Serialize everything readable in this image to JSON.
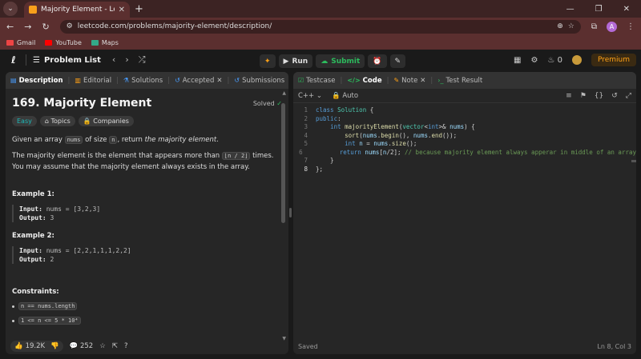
{
  "browser": {
    "tab_title": "Majority Element - LeetCode",
    "tab_close": "✕",
    "new_tab": "+",
    "url": "leetcode.com/problems/majority-element/description/",
    "profile_initial": "A",
    "bookmarks": [
      "Gmail",
      "YouTube",
      "Maps"
    ]
  },
  "leetcode_nav": {
    "problem_list": "Problem List",
    "run": "Run",
    "submit": "Submit",
    "streak": "0",
    "premium": "Premium"
  },
  "left_tabs": {
    "description": "Description",
    "editorial": "Editorial",
    "solutions": "Solutions",
    "accepted": "Accepted",
    "submissions": "Submissions"
  },
  "problem": {
    "title": "169. Majority Element",
    "status": "Solved",
    "difficulty": "Easy",
    "topics": "Topics",
    "companies": "Companies",
    "intro_1": "Given an array ",
    "intro_code_1": "nums",
    "intro_2": " of size ",
    "intro_code_2": "n",
    "intro_3": ", return ",
    "intro_em": "the majority element",
    "intro_4": ".",
    "p2_1": "The majority element is the element that appears more than ",
    "p2_code": "⌊n / 2⌋",
    "p2_2": " times. You may assume that the majority element always exists in the array.",
    "example1_title": "Example 1:",
    "example1_input_label": "Input:",
    "example1_input": " nums = [3,2,3]",
    "example1_output_label": "Output:",
    "example1_output": " 3",
    "example2_title": "Example 2:",
    "example2_input_label": "Input:",
    "example2_input": " nums = [2,2,1,1,1,2,2]",
    "example2_output_label": "Output:",
    "example2_output": " 2",
    "constraints_title": "Constraints:",
    "constraint_1": "n == nums.length",
    "constraint_2": "1 <= n <= 5 * 10⁴"
  },
  "footer": {
    "likes": "19.2K",
    "comments": "252"
  },
  "right_tabs": {
    "testcase": "Testcase",
    "code": "Code",
    "note": "Note",
    "test_result": "Test Result"
  },
  "editor": {
    "language": "C++",
    "mode": "Auto",
    "saved": "Saved",
    "cursor": "Ln 8, Col 3",
    "line_numbers": [
      "1",
      "2",
      "3",
      "4",
      "5",
      "6",
      "7",
      "8"
    ]
  }
}
